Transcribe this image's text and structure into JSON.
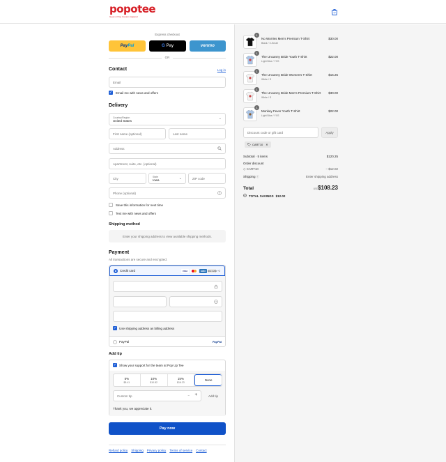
{
  "header": {
    "logo_text": "popotee",
    "logo_tagline": "Geek & Pop Custom Apparel"
  },
  "express": {
    "title": "Express checkout",
    "paypal_label_a": "Pay",
    "paypal_label_b": "Pal",
    "gpay_label_g": "G",
    "gpay_label": "Pay",
    "venmo_label": "venmo",
    "or": "OR"
  },
  "contact": {
    "title": "Contact",
    "login_link": "Log in",
    "email_placeholder": "Email",
    "news_label": "Email me with news and offers"
  },
  "delivery": {
    "title": "Delivery",
    "country_label": "Country/Region",
    "country_value": "United States",
    "first_name": "First name (optional)",
    "last_name": "Last name",
    "address": "Address",
    "apartment": "Apartment, suite, etc. (optional)",
    "city": "City",
    "state_label": "State",
    "state_value": "Iowa",
    "zip": "ZIP code",
    "phone": "Phone (optional)",
    "save_info": "Save this information for next time",
    "text_me": "Text me with news and offers"
  },
  "shipping": {
    "title": "Shipping method",
    "message": "Enter your shipping address to view available shipping methods."
  },
  "payment": {
    "title": "Payment",
    "subtitle": "All transactions are secure and encrypted.",
    "credit_card": "Credit card",
    "card_visa": "VISA",
    "card_amex": "AMEX",
    "card_discover": "DISCOVER",
    "more_cards": "+2",
    "billing_same": "Use shipping address as billing address",
    "paypal_option": "PayPal",
    "paypal_logo": "PayPal"
  },
  "tip": {
    "title": "Add tip",
    "show_support": "Show your support for the team at Pop Up Tee",
    "options": [
      {
        "label": "5%",
        "amount": "$5.41"
      },
      {
        "label": "10%",
        "amount": "$10.82"
      },
      {
        "label": "15%",
        "amount": "$16.23"
      },
      {
        "label": "None",
        "amount": ""
      }
    ],
    "custom_placeholder": "Custom tip",
    "minus": "−",
    "plus": "+",
    "add_button": "Add tip",
    "thanks": "Thank you, we appreciate it."
  },
  "pay_now": "Pay now",
  "footer": {
    "links": [
      "Refund policy",
      "Shipping",
      "Privacy policy",
      "Terms of service",
      "Contact"
    ]
  },
  "cart": {
    "items": [
      {
        "qty": "1",
        "name": "No Worries Men's Premium T-Shirt",
        "variant": "Black / X-Small",
        "price": "$30.00",
        "shirt_color": "#111111"
      },
      {
        "qty": "1",
        "name": "The Uncanny Bride Youth T-Shirt",
        "variant": "Light Blue / YXS",
        "price": "$22.00",
        "shirt_color": "#a9c4e6"
      },
      {
        "qty": "1",
        "name": "The Uncanny Bride Women's T-Shirt",
        "variant": "White / S",
        "price": "$16.25",
        "shirt_color": "#f3f3f3"
      },
      {
        "qty": "1",
        "name": "The Uncanny Bride Men's Premium T-Shirt",
        "variant": "White / S",
        "price": "$30.00",
        "shirt_color": "#f3f3f3"
      },
      {
        "qty": "1",
        "name": "Monkey Fever Youth T-Shirt",
        "variant": "Light Blue / YXS",
        "price": "$22.00",
        "shirt_color": "#a9c4e6"
      }
    ],
    "discount_placeholder": "Discount code or gift card",
    "apply": "Apply",
    "applied_code": "CART10",
    "subtotal_label": "Subtotal · 5 items",
    "subtotal_value": "$120.25",
    "order_discount_label": "Order discount",
    "discount_code": "CART10",
    "discount_value": "− $12.02",
    "shipping_label": "Shipping",
    "shipping_value": "Enter shipping address",
    "total_label": "Total",
    "currency": "USD",
    "total_value": "$108.23",
    "savings_label": "TOTAL SAVINGS",
    "savings_value": "$12.02"
  },
  "colors": {
    "brand_red": "#d71f26",
    "link_blue": "#1f5fd6",
    "pay_button": "#1052c8",
    "paypal_yellow": "#ffc439",
    "venmo_blue": "#3d95ce"
  }
}
